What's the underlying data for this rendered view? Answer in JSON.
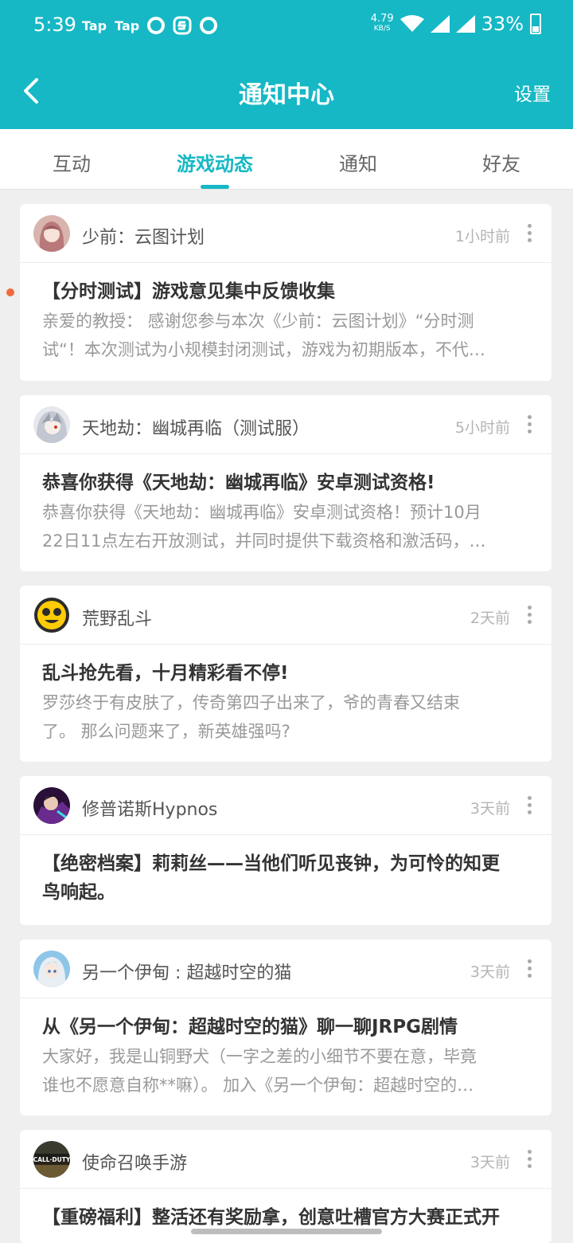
{
  "status_bar": {
    "time": "5:39",
    "apps": [
      "Tap",
      "Tap"
    ],
    "speed": "4.79",
    "speed_unit": "KB/S",
    "battery": "33%"
  },
  "header": {
    "title": "通知中心",
    "settings": "设置"
  },
  "tabs": [
    {
      "label": "互动"
    },
    {
      "label": "游戏动态"
    },
    {
      "label": "通知"
    },
    {
      "label": "好友"
    }
  ],
  "notifications": [
    {
      "game": "少前：云图计划",
      "time": "1小时前",
      "title": "【分时测试】游戏意见集中反馈收集",
      "desc1": "亲爱的教授： 感谢您参与本次《少前：云图计划》“分时测",
      "desc2": "试“！本次测试为小规模封闭测试，游戏为初期版本，不代…"
    },
    {
      "game": "天地劫：幽城再临（测试服）",
      "time": "5小时前",
      "title": "恭喜你获得《天地劫：幽城再临》安卓测试资格!",
      "desc1": "恭喜你获得《天地劫：幽城再临》安卓测试资格！预计10月",
      "desc2": "22日11点左右开放测试，并同时提供下载资格和激活码，…"
    },
    {
      "game": "荒野乱斗",
      "time": "2天前",
      "title": "乱斗抢先看，十月精彩看不停!",
      "desc1": "罗莎终于有皮肤了，传奇第四子出来了，爷的青春又结束",
      "desc2": "了。 那么问题来了，新英雄强吗?"
    },
    {
      "game": "修普诺斯Hypnos",
      "time": "3天前",
      "title1": "【绝密档案】莉莉丝——当他们听见丧钟，为可怜的知更",
      "title2": "鸟响起。"
    },
    {
      "game": "另一个伊甸 : 超越时空的猫",
      "time": "3天前",
      "title": "从《另一个伊甸：超越时空的猫》聊一聊JRPG剧情",
      "desc1": "大家好，我是山铜野犬（一字之差的小细节不要在意，毕竟",
      "desc2": "谁也不愿意自称**嘛）。  加入《另一个伊甸：超越时空的…"
    },
    {
      "game": "使命召唤手游",
      "time": "3天前",
      "title": "【重磅福利】整活还有奖励拿，创意吐槽官方大赛正式开"
    }
  ],
  "avatar_text": "CALL·DUTY"
}
